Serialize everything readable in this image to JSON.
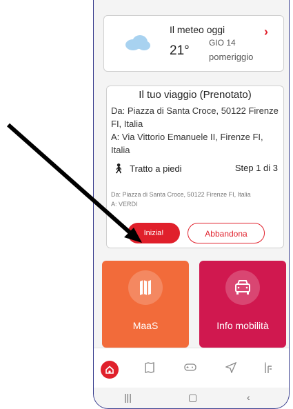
{
  "weather": {
    "title": "Il meteo oggi",
    "temperature": "21°",
    "day": "GIO 14",
    "time_of_day": "pomeriggio",
    "icon": "cloud-icon"
  },
  "trip": {
    "title": "Il tuo viaggio (Prenotato)",
    "from": "Da: Piazza di Santa Croce, 50122 Firenze FI, Italia",
    "to": "A: Via Vittorio Emanuele II, Firenze FI, Italia",
    "segment_label": "Tratto a piedi",
    "step": "Step 1 di 3",
    "detail_from": "Da: Piazza di Santa Croce, 50122 Firenze FI, Italia",
    "detail_to": "A: VERDI",
    "start_button": "Inizia!",
    "abandon_button": "Abbandona"
  },
  "tiles": [
    {
      "label": "MaaS",
      "icon": "map-icon",
      "color": "#f26b3a"
    },
    {
      "label": "Info mobilità",
      "icon": "car-icon",
      "color": "#d0184f"
    }
  ],
  "bottom_nav": [
    "home-icon",
    "map-icon",
    "gamepad-icon",
    "navigation-icon",
    "info-icon"
  ],
  "colors": {
    "accent": "#e0202b"
  }
}
